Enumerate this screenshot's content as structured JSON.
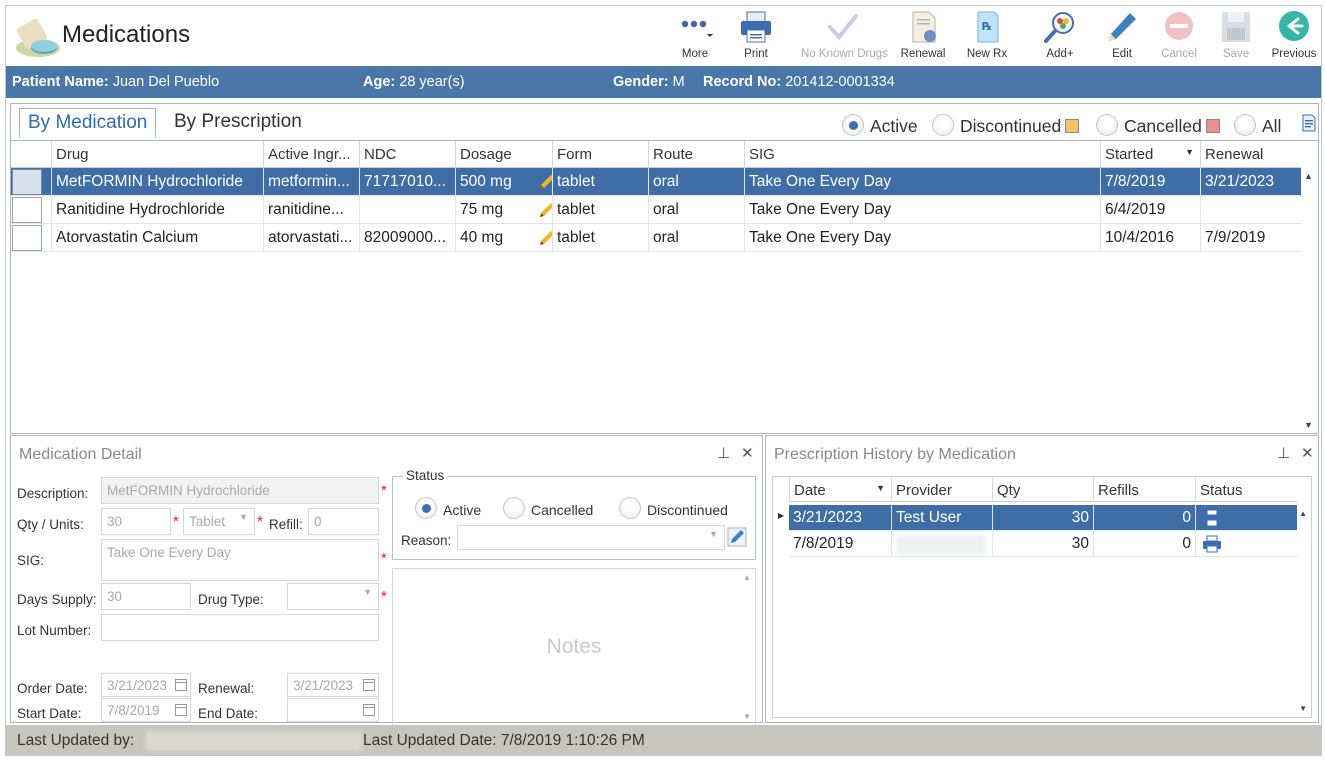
{
  "app": {
    "title": "Medications"
  },
  "toolbar": {
    "more": "More",
    "print": "Print",
    "no_known_drugs": "No Known Drugs",
    "renewal": "Renewal",
    "new_rx": "New Rx",
    "add_plus": "Add+",
    "edit": "Edit",
    "cancel": "Cancel",
    "save": "Save",
    "previous": "Previous"
  },
  "patient": {
    "name_label": "Patient Name:",
    "name": "Juan Del Pueblo",
    "age_label": "Age:",
    "age": "28 year(s)",
    "gender_label": "Gender:",
    "gender": "M",
    "record_label": "Record No:",
    "record": "201412-0001334"
  },
  "tabs": {
    "by_medication": "By Medication",
    "by_prescription": "By Prescription"
  },
  "filters": {
    "active": "Active",
    "discontinued": "Discontinued",
    "cancelled": "Cancelled",
    "all": "All",
    "selected": "Active",
    "discontinued_color": "#f6c56b",
    "cancelled_color": "#ee8f8f"
  },
  "grid": {
    "columns": [
      "Drug",
      "Active Ingr...",
      "NDC",
      "Dosage",
      "Form",
      "Route",
      "SIG",
      "Started",
      "Renewal"
    ],
    "rows": [
      {
        "drug": "MetFORMIN Hydrochloride",
        "ingredient": "metformin...",
        "ndc": "71717010...",
        "dosage": "500 mg",
        "form": "tablet",
        "route": "oral",
        "sig": "Take One Every Day",
        "started": "7/8/2019",
        "renewal": "3/21/2023"
      },
      {
        "drug": "Ranitidine Hydrochloride",
        "ingredient": "ranitidine...",
        "ndc": "",
        "dosage": "75 mg",
        "form": "tablet",
        "route": "oral",
        "sig": "Take One Every Day",
        "started": "6/4/2019",
        "renewal": ""
      },
      {
        "drug": "Atorvastatin Calcium",
        "ingredient": "atorvastati...",
        "ndc": "82009000...",
        "dosage": "40 mg",
        "form": "tablet",
        "route": "oral",
        "sig": "Take One Every Day",
        "started": "10/4/2016",
        "renewal": "7/9/2019"
      }
    ]
  },
  "detail": {
    "title": "Medication Detail",
    "description_label": "Description:",
    "description": "MetFORMIN Hydrochloride",
    "qty_label": "Qty / Units:",
    "qty": "30",
    "units": "Tablet",
    "refill_label": "Refill:",
    "refill": "0",
    "sig_label": "SIG:",
    "sig": "Take One Every Day",
    "days_supply_label": "Days Supply:",
    "days_supply": "30",
    "drug_type_label": "Drug Type:",
    "drug_type": "",
    "lot_label": "Lot Number:",
    "lot": "",
    "order_date_label": "Order Date:",
    "order_date": "3/21/2023",
    "renewal_label": "Renewal:",
    "renewal": "3/21/2023",
    "start_date_label": "Start Date:",
    "start_date": "7/8/2019",
    "end_date_label": "End Date:",
    "end_date": "",
    "status_legend": "Status",
    "status_active": "Active",
    "status_cancelled": "Cancelled",
    "status_discontinued": "Discontinued",
    "reason_label": "Reason:",
    "notes_placeholder": "Notes"
  },
  "history": {
    "title": "Prescription History by Medication",
    "columns": [
      "Date",
      "Provider",
      "Qty",
      "Refills",
      "Status"
    ],
    "rows": [
      {
        "date": "3/21/2023",
        "provider": "Test User",
        "qty": "30",
        "refills": "0"
      },
      {
        "date": "7/8/2019",
        "provider": "",
        "qty": "30",
        "refills": "0"
      }
    ]
  },
  "footer": {
    "updated_by_label": "Last Updated by:",
    "updated_date": "Last Updated Date: 7/8/2019 1:10:26 PM"
  },
  "colors": {
    "accent": "#4a76a8",
    "selected_row": "#3f6ea6",
    "footer": "#c7c6bd"
  }
}
